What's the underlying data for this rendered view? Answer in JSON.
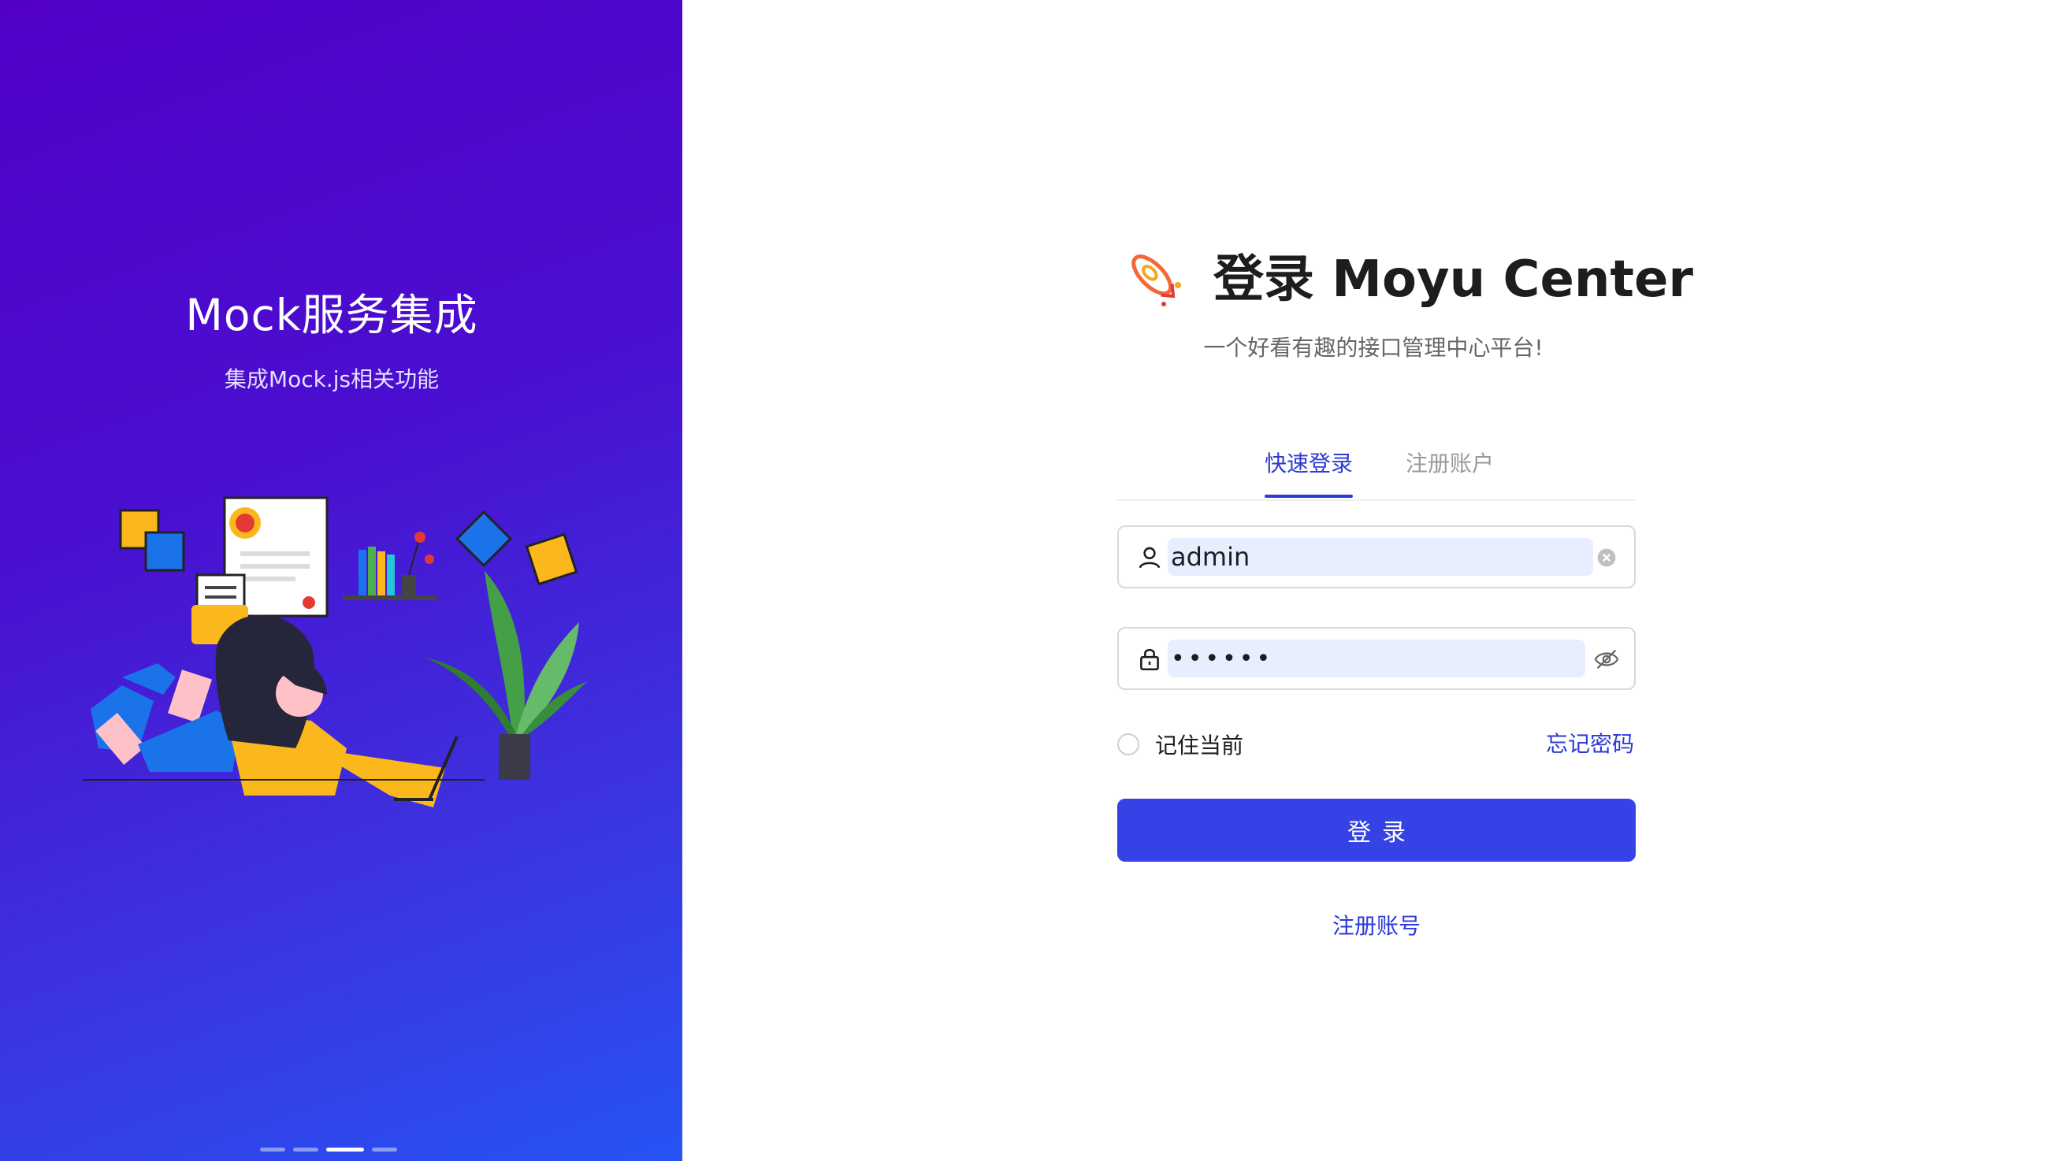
{
  "banner": {
    "title": "Mock服务集成",
    "subtitle": "集成Mock.js相关功能",
    "carousel_count": 4,
    "carousel_active_index": 2
  },
  "header": {
    "title": "登录 Moyu Center",
    "subtitle": "一个好看有趣的接口管理中心平台!",
    "logo_icon": "rocket-icon"
  },
  "tabs": [
    {
      "label": "快速登录",
      "active": true
    },
    {
      "label": "注册账户",
      "active": false
    }
  ],
  "form": {
    "username_value": "admin",
    "password_value": "123456",
    "remember_label": "记住当前",
    "remember_checked": false,
    "forgot_label": "忘记密码",
    "submit_label": "登录",
    "register_link": "注册账号"
  },
  "colors": {
    "accent": "#3442e6",
    "banner_start": "#5200c8",
    "banner_end": "#2653f5"
  }
}
